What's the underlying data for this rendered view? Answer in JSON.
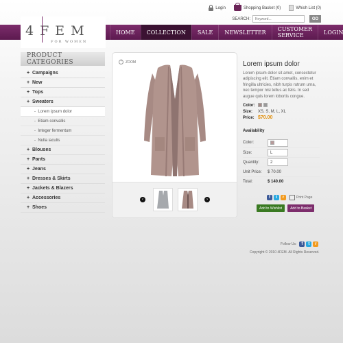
{
  "header": {
    "login": "Login",
    "basket": "Shopping Basket (0)",
    "wishlist": "Whish List (0)",
    "search_label": "SEARCH:",
    "search_placeholder": "Keyword...",
    "go": "GO"
  },
  "brand": {
    "logo": "4FEM",
    "tagline": "FOR WOMEN"
  },
  "nav": {
    "items": [
      "HOME",
      "COLLECTION",
      "SALE",
      "NEWSLETTER",
      "CUSTOMER SERVICE",
      "LOGIN"
    ],
    "active": "COLLECTION"
  },
  "sidebar": {
    "title": "PRODUCT CATEGORIES",
    "items": [
      "Campaigns",
      "New",
      "Tops",
      "Sweaters"
    ],
    "sub_items": [
      "Lorem ipsum dolor",
      "Etiam convallis",
      "Integer fermentum",
      "Nulla iaculis"
    ],
    "items_after": [
      "Blouses",
      "Pants",
      "Jeans",
      "Dresses & Skirts",
      "Jackets & Blazers",
      "Accessories",
      "Shoes"
    ],
    "selected": "Lorem ipsum dolor"
  },
  "gallery": {
    "zoom": "ZOOM"
  },
  "product": {
    "title": "Lorem ipsum dolor",
    "description": "Lorem ipsum dolor sit amet, consectetur adipiscing elit. Etiam convallis, enim et fringilla ultricies, nibh turpis rutrum urna, nec tempor nisi tellus ac felis. In sed augue quis lorem lobortis congue.",
    "color_label": "Color:",
    "colors": [
      "#a58a86",
      "#9a9a9a"
    ],
    "size_label": "Size:",
    "sizes": "XS, S, M, L, XL",
    "price_label": "Price:",
    "price": "$70.00"
  },
  "availability": {
    "title": "Availability",
    "color_label": "Color:",
    "color_value": "#b79a9a",
    "size_label": "Size:",
    "size_value": "L",
    "qty_label": "Quantity:",
    "qty_value": "2",
    "unit_label": "Unit Price:",
    "unit_value": "$ 70.00",
    "total_label": "Total:",
    "total_value": "$ 140.00"
  },
  "actions": {
    "print": "Print Page",
    "wishlist": "Add to Wishlist",
    "basket": "Add to Basket"
  },
  "footer": {
    "follow": "Follow Us:",
    "copyright": "Copyright © 2010 4FEM. All Rights Reserved."
  }
}
